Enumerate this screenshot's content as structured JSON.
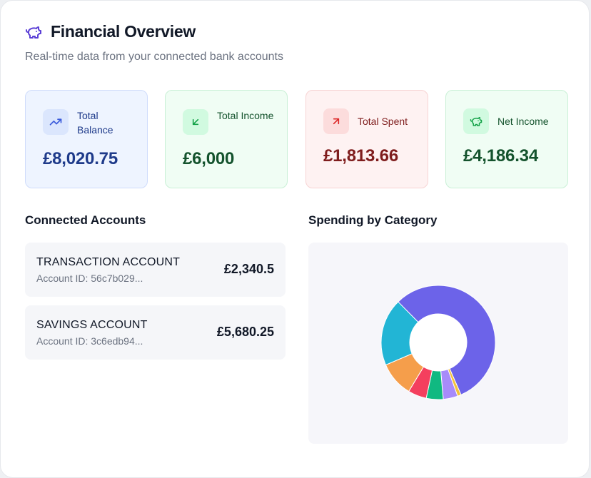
{
  "header": {
    "title": "Financial Overview",
    "subtitle": "Real-time data from your connected bank accounts",
    "icon": "piggy-bank-icon"
  },
  "stats": [
    {
      "label": "Total Balance",
      "value": "£8,020.75",
      "icon": "trending-up-icon",
      "color": "#1e3a8a"
    },
    {
      "label": "Total Income",
      "value": "£6,000",
      "icon": "arrow-down-left-icon",
      "color": "#14532d"
    },
    {
      "label": "Total Spent",
      "value": "£1,813.66",
      "icon": "arrow-up-right-icon",
      "color": "#7f1d1d"
    },
    {
      "label": "Net Income",
      "value": "£4,186.34",
      "icon": "piggy-bank-icon",
      "color": "#14532d"
    }
  ],
  "accounts_section": {
    "title": "Connected Accounts",
    "items": [
      {
        "name": "TRANSACTION ACCOUNT",
        "id": "Account ID: 56c7b029...",
        "balance": "£2,340.5"
      },
      {
        "name": "SAVINGS ACCOUNT",
        "id": "Account ID: 3c6edb94...",
        "balance": "£5,680.25"
      }
    ]
  },
  "spending_section": {
    "title": "Spending by Category"
  },
  "chart_data": {
    "type": "pie",
    "donut": true,
    "slices": [
      {
        "value": 49.0,
        "color": "#6c63e9"
      },
      {
        "value": 0.9,
        "color": "#f3c23c"
      },
      {
        "value": 3.6,
        "color": "#a78bfa"
      },
      {
        "value": 4.2,
        "color": "#10b981"
      },
      {
        "value": 4.6,
        "color": "#f43f5e"
      },
      {
        "value": 8.7,
        "color": "#f59e4b"
      },
      {
        "value": 16.7,
        "color": "#22b5d5"
      }
    ]
  }
}
